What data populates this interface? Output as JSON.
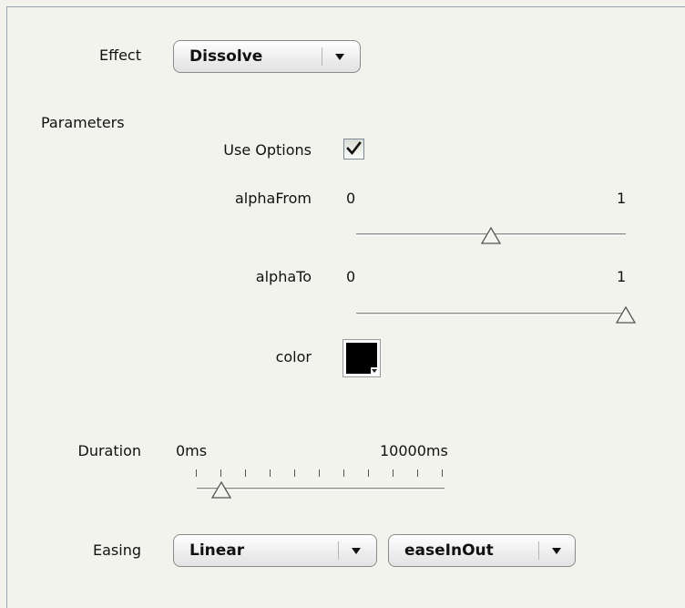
{
  "effect": {
    "label": "Effect",
    "selected": "Dissolve"
  },
  "parameters": {
    "label": "Parameters",
    "use_options": {
      "label": "Use Options",
      "checked": true
    },
    "alpha_from": {
      "label": "alphaFrom",
      "min_label": "0",
      "max_label": "1",
      "value": 0.5
    },
    "alpha_to": {
      "label": "alphaTo",
      "min_label": "0",
      "max_label": "1",
      "value": 1.0
    },
    "color": {
      "label": "color",
      "value": "#000000"
    }
  },
  "duration": {
    "label": "Duration",
    "min_label": "0ms",
    "max_label": "10000ms",
    "value_fraction": 0.1,
    "tick_count": 11
  },
  "easing": {
    "label": "Easing",
    "type_selected": "Linear",
    "mode_selected": "easeInOut"
  },
  "colors": {
    "background": "#f3f3ee",
    "border": "#99a4ad",
    "check": "#111111"
  },
  "icons": {
    "combo_arrow": "chevron-down-icon",
    "checkmark": "check-icon",
    "slider_thumb": "triangle-up-icon",
    "color_dropdown": "caret-down-icon"
  }
}
